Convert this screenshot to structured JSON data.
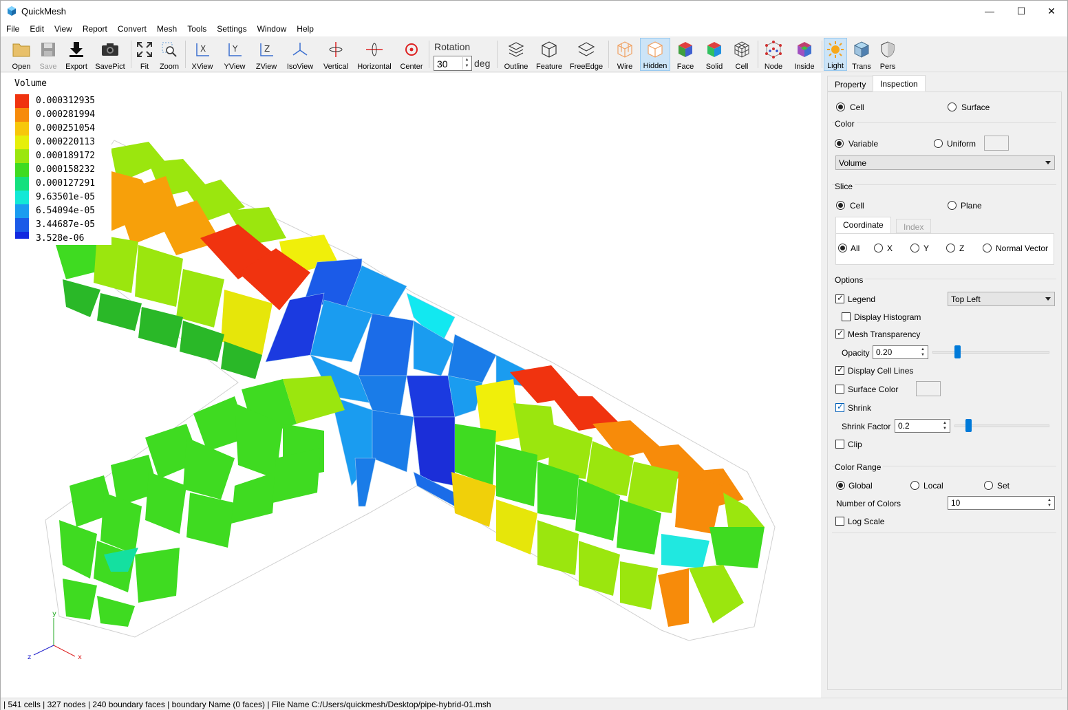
{
  "app": {
    "title": "QuickMesh"
  },
  "window_controls": {
    "minimize": "—",
    "maximize": "☐",
    "close": "✕"
  },
  "menu": [
    "File",
    "Edit",
    "View",
    "Report",
    "Convert",
    "Mesh",
    "Tools",
    "Settings",
    "Window",
    "Help"
  ],
  "toolbar": {
    "buttons": [
      {
        "label": "Open",
        "icon": "folder-icon"
      },
      {
        "label": "Save",
        "icon": "save-icon",
        "disabled": true
      },
      {
        "label": "Export",
        "icon": "download-icon"
      },
      {
        "label": "SavePict",
        "icon": "camera-icon"
      },
      {
        "label": "Fit",
        "icon": "fit-icon"
      },
      {
        "label": "Zoom",
        "icon": "zoom-icon"
      },
      {
        "label": "XView",
        "icon": "xview-icon"
      },
      {
        "label": "YView",
        "icon": "yview-icon"
      },
      {
        "label": "ZView",
        "icon": "zview-icon"
      },
      {
        "label": "IsoView",
        "icon": "isoview-icon"
      },
      {
        "label": "Vertical",
        "icon": "vertical-rotate-icon"
      },
      {
        "label": "Horizontal",
        "icon": "horizontal-rotate-icon"
      },
      {
        "label": "Center",
        "icon": "center-icon"
      },
      {
        "label": "Outline",
        "icon": "outline-icon"
      },
      {
        "label": "Feature",
        "icon": "feature-icon"
      },
      {
        "label": "FreeEdge",
        "icon": "freeedge-icon"
      },
      {
        "label": "Wire",
        "icon": "wire-icon"
      },
      {
        "label": "Hidden",
        "icon": "hidden-icon",
        "active": true
      },
      {
        "label": "Face",
        "icon": "face-icon"
      },
      {
        "label": "Solid",
        "icon": "solid-icon"
      },
      {
        "label": "Cell",
        "icon": "cell-icon"
      },
      {
        "label": "Node",
        "icon": "node-icon"
      },
      {
        "label": "Inside",
        "icon": "inside-icon"
      },
      {
        "label": "Light",
        "icon": "light-icon",
        "active": true
      },
      {
        "label": "Trans",
        "icon": "trans-icon"
      },
      {
        "label": "Pers",
        "icon": "pers-icon"
      }
    ],
    "rotation": {
      "label": "Rotation",
      "value": "30",
      "unit": "deg"
    }
  },
  "legend": {
    "title": "Volume",
    "entries": [
      {
        "value": "0.000312935",
        "color": "#f0330f"
      },
      {
        "value": "0.000281994",
        "color": "#f78b0a"
      },
      {
        "value": "0.000251054",
        "color": "#f7c70a"
      },
      {
        "value": "0.000220113",
        "color": "#e6ef0a"
      },
      {
        "value": "0.000189172",
        "color": "#9be60e"
      },
      {
        "value": "0.000158232",
        "color": "#3fdb21"
      },
      {
        "value": "0.000127291",
        "color": "#14e07e"
      },
      {
        "value": "9.63501e-05",
        "color": "#12e8d6"
      },
      {
        "value": "6.54094e-05",
        "color": "#1a9cf0"
      },
      {
        "value": "3.44687e-05",
        "color": "#1b5be8"
      },
      {
        "value": "3.528e-06",
        "color": "#1229e0"
      }
    ]
  },
  "axes": {
    "x": "x",
    "y": "y",
    "z": "z"
  },
  "panel": {
    "tabs": [
      "Property",
      "Inspection"
    ],
    "active_tab": "Inspection",
    "target": {
      "cell": "Cell",
      "surface": "Surface"
    },
    "color": {
      "heading": "Color",
      "variable": "Variable",
      "uniform": "Uniform",
      "variable_select": "Volume"
    },
    "slice": {
      "heading": "Slice",
      "cell": "Cell",
      "plane": "Plane",
      "subtabs": [
        "Coordinate",
        "Index"
      ],
      "options": [
        "All",
        "X",
        "Y",
        "Z",
        "Normal Vector"
      ]
    },
    "options": {
      "heading": "Options",
      "legend": "Legend",
      "legend_position": "Top Left",
      "display_histogram": "Display Histogram",
      "mesh_transparency": "Mesh Transparency",
      "opacity_label": "Opacity",
      "opacity_value": "0.20",
      "display_cell_lines": "Display Cell Lines",
      "surface_color": "Surface Color",
      "shrink": "Shrink",
      "shrink_factor_label": "Shrink Factor",
      "shrink_factor_value": "0.2",
      "clip": "Clip"
    },
    "color_range": {
      "heading": "Color Range",
      "global": "Global",
      "local": "Local",
      "set": "Set",
      "num_colors_label": "Number of Colors",
      "num_colors_value": "10",
      "log_scale": "Log Scale"
    }
  },
  "status": "| 541 cells | 327 nodes | 240 boundary faces |  boundary Name  (0 faces) | File Name C:/Users/quickmesh/Desktop/pipe-hybrid-01.msh"
}
